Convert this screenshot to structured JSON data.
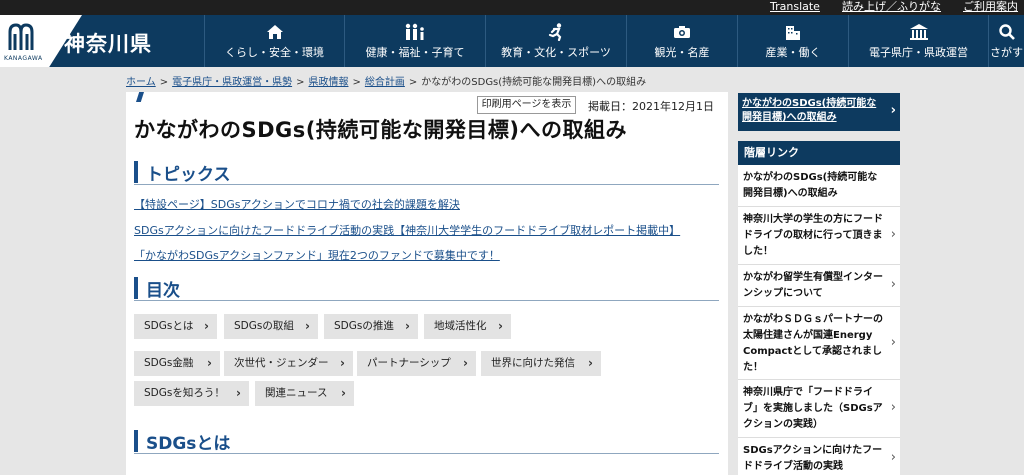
{
  "utility": {
    "translate": "Translate",
    "readaloud": "読み上げ／ふりがな",
    "guide": "ご利用案内"
  },
  "site": {
    "title": "神奈川県",
    "logo_sub": "KANAGAWA"
  },
  "nav": [
    {
      "label": "くらし・安全・環境",
      "icon": "home-icon"
    },
    {
      "label": "健康・福祉・子育て",
      "icon": "family-icon"
    },
    {
      "label": "教育・文化・スポーツ",
      "icon": "runner-icon"
    },
    {
      "label": "観光・名産",
      "icon": "camera-icon"
    },
    {
      "label": "産業・働く",
      "icon": "building-icon"
    },
    {
      "label": "電子県庁・県政運営",
      "icon": "government-icon"
    },
    {
      "label": "さがす",
      "icon": "search-icon"
    }
  ],
  "breadcrumb": {
    "links": [
      "ホーム",
      "電子県庁・県政運営・県勢",
      "県政情報",
      "総合計画"
    ],
    "current": "かながわのSDGs(持続可能な開発目標)への取組み",
    "separator": ">"
  },
  "main": {
    "print_label": "印刷用ページを表示",
    "pubdate": "掲載日：2021年12月1日",
    "title": "かながわのSDGs(持続可能な開発目標)への取組み",
    "topics_heading": "トピックス",
    "topics": [
      "【特設ページ】SDGsアクションでコロナ禍での社会的課題を解決",
      "SDGsアクションに向けたフードドライブ活動の実践【神奈川大学学生のフードドライブ取材レポート掲載中】",
      "「かながわSDGsアクションファンド」現在2つのファンドで募集中です！"
    ],
    "toc_heading": "目次",
    "toc": [
      "SDGsとは",
      "SDGsの取組",
      "SDGsの推進",
      "地域活性化",
      "SDGs金融",
      "次世代・ジェンダー",
      "パートナーシップ",
      "世界に向けた発信",
      "SDGsを知ろう！",
      "関連ニュース"
    ],
    "section_heading": "SDGsとは"
  },
  "sidebar": {
    "top_link": "かながわのSDGs(持続可能な開発目標)への取組み",
    "heading": "階層リンク",
    "items": [
      "かながわのSDGs(持続可能な開発目標)への取組み",
      "神奈川大学の学生の方にフードドライブの取材に行って頂きました！",
      "かながわ留学生有償型インターンシップについて",
      "かながわＳＤＧｓパートナーの太陽住建さんが国連Energy Compactとして承認されました！",
      "神奈川県庁で「フードドライブ」を実施しました（SDGsアクションの実践）",
      "SDGsアクションに向けたフードドライブ活動の実践"
    ]
  },
  "colors": {
    "header": "#0d3a5f",
    "link": "#1a4f8a",
    "utilbar": "#1f1f1f"
  }
}
